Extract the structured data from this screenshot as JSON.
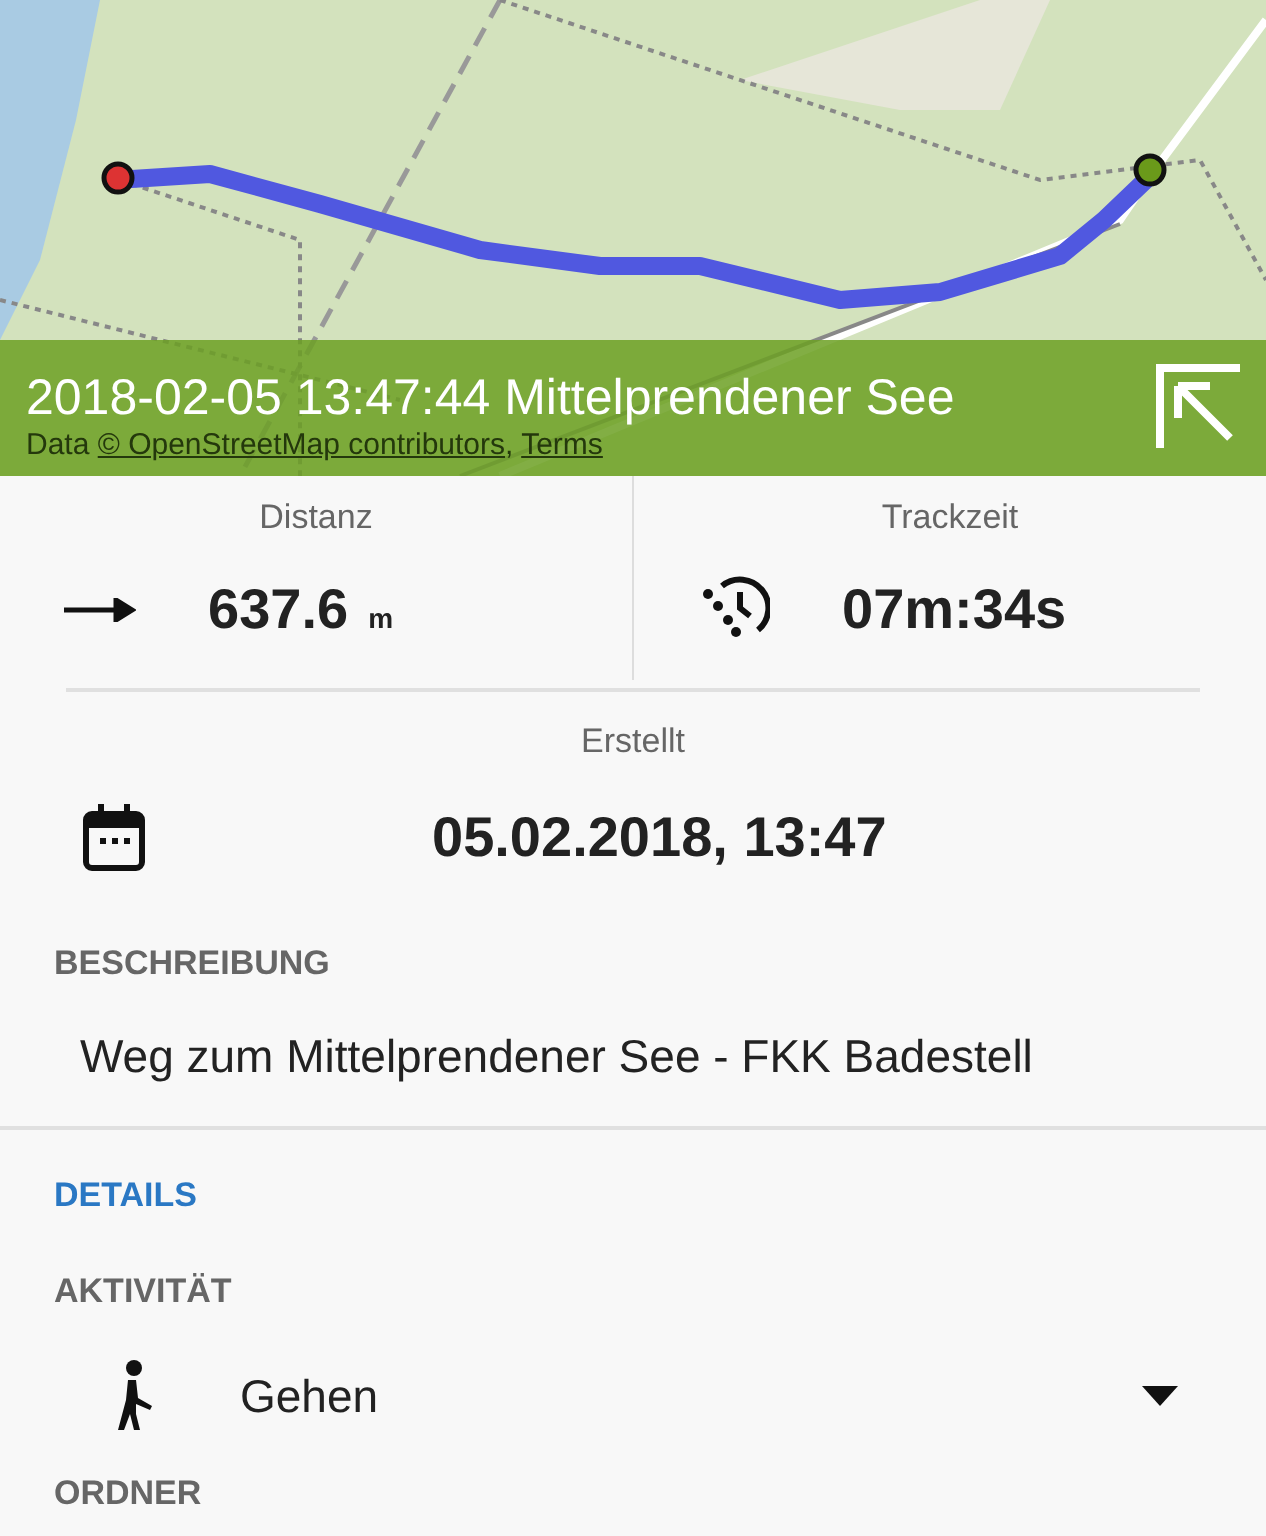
{
  "map": {
    "kind": "picture",
    "attribution_prefix": "Data ",
    "attribution_links": [
      "© OpenStreetMap contributors",
      "Terms"
    ],
    "attribution_separator": ", "
  },
  "banner": {
    "title": "2018-02-05 13:47:44 Mittelprendener See"
  },
  "stats": [
    {
      "label": "Distanz",
      "value": "637.6",
      "unit": "m"
    },
    {
      "label": "Trackzeit",
      "value": "07m:34s"
    }
  ],
  "created": {
    "label": "Erstellt",
    "value": "05.02.2018, 13:47"
  },
  "description": {
    "label": "BESCHREIBUNG",
    "text": "Weg zum Mittelprendener See - FKK Badestell"
  },
  "details": {
    "heading": "DETAILS",
    "activity_label": "AKTIVITÄT",
    "activity": "Gehen",
    "folder_label": "ORDNER"
  }
}
